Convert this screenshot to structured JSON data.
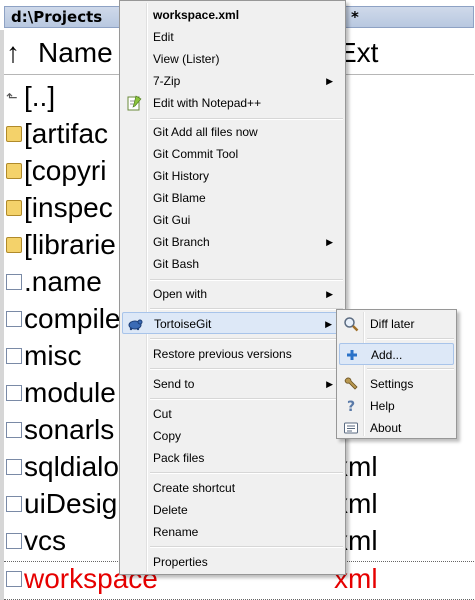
{
  "panel": {
    "path": "d:\\Projects",
    "path_star": "*",
    "sort_arrow": "↑",
    "col_name": "Name",
    "col_ext": "Ext",
    "rows": [
      {
        "name": "[..]",
        "ext": "",
        "icon": "up-folder-icon"
      },
      {
        "name": "[artifac",
        "ext": "",
        "icon": "folder-icon"
      },
      {
        "name": "[copyri",
        "ext": "",
        "icon": "folder-icon"
      },
      {
        "name": "[inspec",
        "ext": "",
        "icon": "folder-icon"
      },
      {
        "name": "[librarie",
        "ext": "",
        "icon": "folder-icon"
      },
      {
        "name": ".name",
        "ext": "",
        "icon": "file-icon"
      },
      {
        "name": "compile",
        "ext": "",
        "icon": "xml-file-icon"
      },
      {
        "name": "misc",
        "ext": "",
        "icon": "xml-file-icon"
      },
      {
        "name": "module",
        "ext": "",
        "icon": "xml-file-icon"
      },
      {
        "name": "sonarls",
        "ext": "",
        "icon": "xml-file-icon"
      },
      {
        "name": "sqldialo",
        "ext": "xml",
        "icon": "xml-file-icon"
      },
      {
        "name": "uiDesig",
        "ext": "xml",
        "icon": "xml-file-icon"
      },
      {
        "name": "vcs",
        "ext": "xml",
        "icon": "xml-file-icon"
      },
      {
        "name": "workspace",
        "ext": "xml",
        "icon": "xml-file-icon"
      }
    ],
    "selected_color": "#e60000"
  },
  "menu": {
    "items": [
      {
        "label": "workspace.xml"
      },
      {
        "label": "Edit"
      },
      {
        "label": "View (Lister)"
      },
      {
        "label": "7-Zip"
      },
      {
        "label": "Edit with Notepad++",
        "icon": "notepad-plus-plus-icon"
      },
      {
        "label": "Git Add all files now"
      },
      {
        "label": "Git Commit Tool"
      },
      {
        "label": "Git History"
      },
      {
        "label": "Git Blame"
      },
      {
        "label": "Git Gui"
      },
      {
        "label": "Git Branch"
      },
      {
        "label": "Git Bash"
      },
      {
        "label": "Open with"
      },
      {
        "label": "TortoiseGit",
        "icon": "tortoisegit-icon"
      },
      {
        "label": "Restore previous versions"
      },
      {
        "label": "Send to"
      },
      {
        "label": "Cut"
      },
      {
        "label": "Copy"
      },
      {
        "label": "Pack files"
      },
      {
        "label": "Create shortcut"
      },
      {
        "label": "Delete"
      },
      {
        "label": "Rename"
      },
      {
        "label": "Properties"
      }
    ],
    "submenu_arrow": "▶"
  },
  "submenu": {
    "items": [
      {
        "label": "Diff later",
        "icon": "magnifier-icon"
      },
      {
        "label": "Add...",
        "icon": "add-icon"
      },
      {
        "label": "Settings",
        "icon": "wrench-icon"
      },
      {
        "label": "Help",
        "icon": "help-icon"
      },
      {
        "label": "About",
        "icon": "about-icon"
      }
    ]
  }
}
